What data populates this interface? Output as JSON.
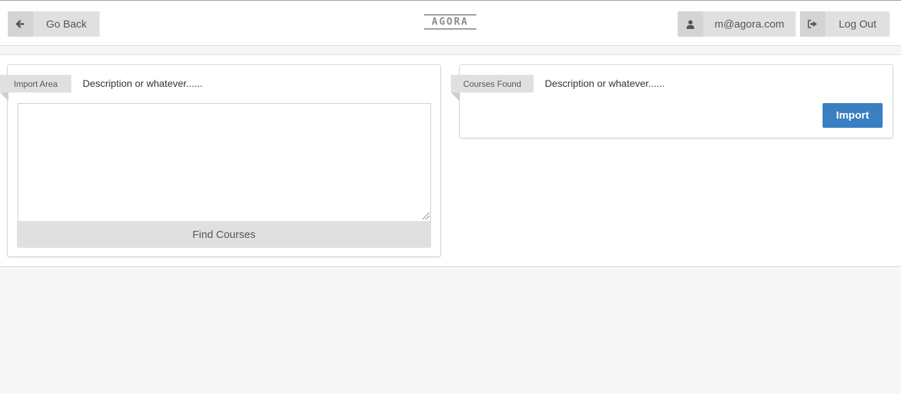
{
  "header": {
    "back_label": "Go Back",
    "logo_text": "AGORA",
    "user_email": "m@agora.com",
    "logout_label": "Log Out"
  },
  "import_panel": {
    "ribbon": "Import Area",
    "description": "Description or whatever......",
    "textarea_value": "",
    "find_label": "Find Courses"
  },
  "found_panel": {
    "ribbon": "Courses Found",
    "description": "Description or whatever......",
    "import_label": "Import"
  },
  "icons": {
    "back": "arrow-left-icon",
    "user": "user-icon",
    "logout": "sign-out-icon"
  },
  "colors": {
    "primary": "#3a7fc1",
    "button_gray": "#e0e0e0",
    "background": "#f6f6f6"
  }
}
